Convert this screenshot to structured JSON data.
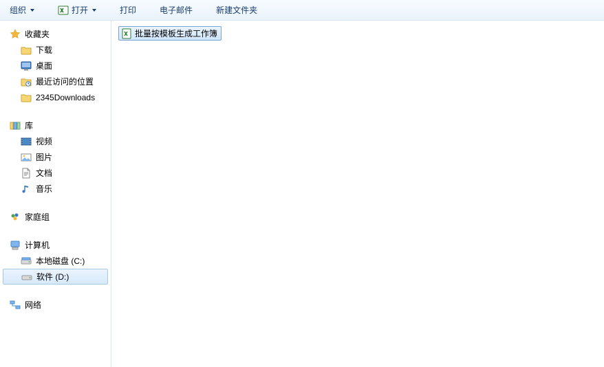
{
  "toolbar": {
    "organize": "组织",
    "open": "打开",
    "print": "打印",
    "email": "电子邮件",
    "new_folder": "新建文件夹"
  },
  "sidebar": {
    "favorites": {
      "header": "收藏夹",
      "items": [
        "下载",
        "桌面",
        "最近访问的位置",
        "2345Downloads"
      ]
    },
    "libraries": {
      "header": "库",
      "items": [
        "视频",
        "图片",
        "文档",
        "音乐"
      ]
    },
    "homegroup": {
      "header": "家庭组"
    },
    "computer": {
      "header": "计算机",
      "items": [
        "本地磁盘 (C:)",
        "软件 (D:)"
      ],
      "selected_index": 1
    },
    "network": {
      "header": "网络"
    }
  },
  "content": {
    "files": [
      "批量按模板生成工作簿"
    ]
  }
}
